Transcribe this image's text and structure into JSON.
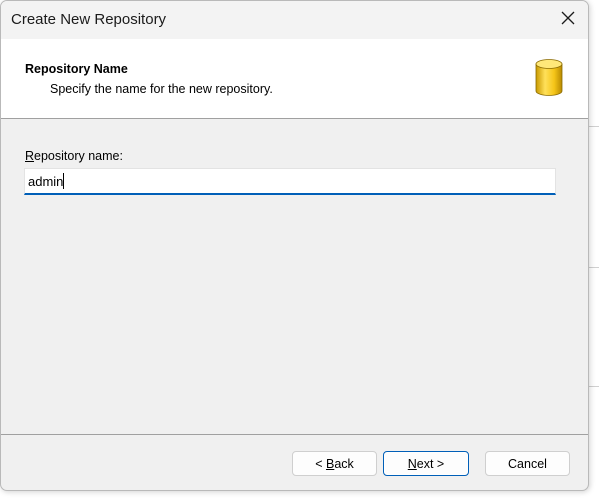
{
  "window": {
    "title": "Create New Repository",
    "close_icon": "close-icon"
  },
  "header": {
    "title": "Repository Name",
    "subtitle": "Specify the name for the new repository.",
    "icon": "database-icon",
    "icon_color": "#f5c518"
  },
  "form": {
    "label_prefix": "R",
    "label_rest": "epository name:",
    "value": "admin"
  },
  "buttons": {
    "back_prefix": "< ",
    "back_key": "B",
    "back_rest": "ack",
    "next_key": "N",
    "next_rest": "ext >",
    "cancel": "Cancel"
  },
  "colors": {
    "accent": "#005fb8",
    "dialog_bg": "#f0f0f0"
  }
}
